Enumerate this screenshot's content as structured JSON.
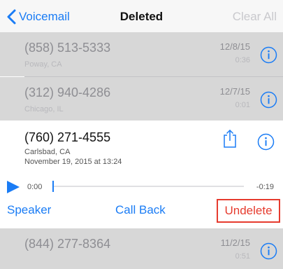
{
  "nav": {
    "back_label": "Voicemail",
    "title": "Deleted",
    "clear_all": "Clear All"
  },
  "voicemails": [
    {
      "number": "(858) 513-5333",
      "location": "Poway, CA",
      "date": "12/8/15",
      "duration": "0:36"
    },
    {
      "number": "(312) 940-4286",
      "location": "Chicago, IL",
      "date": "12/7/15",
      "duration": "0:01"
    },
    {
      "number": "(844) 277-8364",
      "date": "11/2/15",
      "duration": "0:51"
    }
  ],
  "selected": {
    "number": "(760) 271-4555",
    "location": "Carlsbad, CA",
    "date": "November 19, 2015 at 13:24",
    "elapsed": "0:00",
    "remaining": "-0:19",
    "progress": 0
  },
  "actions": {
    "speaker": "Speaker",
    "call_back": "Call Back",
    "undelete": "Undelete"
  },
  "colors": {
    "accent": "#1a7cf5",
    "highlight": "#e63b2e",
    "deleted_row_bg": "#d7d7d7"
  }
}
